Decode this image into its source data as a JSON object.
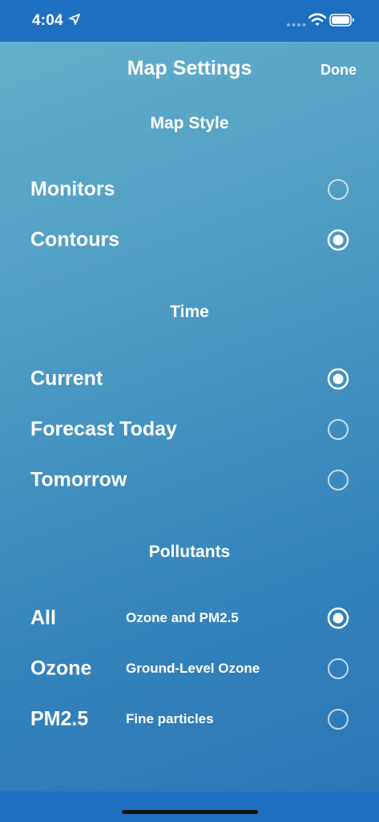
{
  "status_bar": {
    "time": "4:04",
    "location_icon": "location-arrow-icon",
    "signal_icon": "cellular-dots-icon",
    "wifi_icon": "wifi-icon",
    "battery_icon": "battery-icon"
  },
  "nav": {
    "title": "Map Settings",
    "done_label": "Done"
  },
  "map_style": {
    "header": "Map Style",
    "options": [
      {
        "label": "Monitors",
        "selected": false
      },
      {
        "label": "Contours",
        "selected": true
      }
    ]
  },
  "time": {
    "header": "Time",
    "options": [
      {
        "label": "Current",
        "selected": true
      },
      {
        "label": "Forecast Today",
        "selected": false
      },
      {
        "label": "Tomorrow",
        "selected": false
      }
    ]
  },
  "pollutants": {
    "header": "Pollutants",
    "options": [
      {
        "label": "All",
        "description": "Ozone and PM2.5",
        "selected": true
      },
      {
        "label": "Ozone",
        "description": "Ground-Level Ozone",
        "selected": false
      },
      {
        "label": "PM2.5",
        "description": "Fine particles",
        "selected": false
      }
    ]
  },
  "colors": {
    "status_bar": "#1f6fc0",
    "gradient_top": "#66b1cc",
    "gradient_bottom": "#2a74b6",
    "text": "#ffffff"
  }
}
